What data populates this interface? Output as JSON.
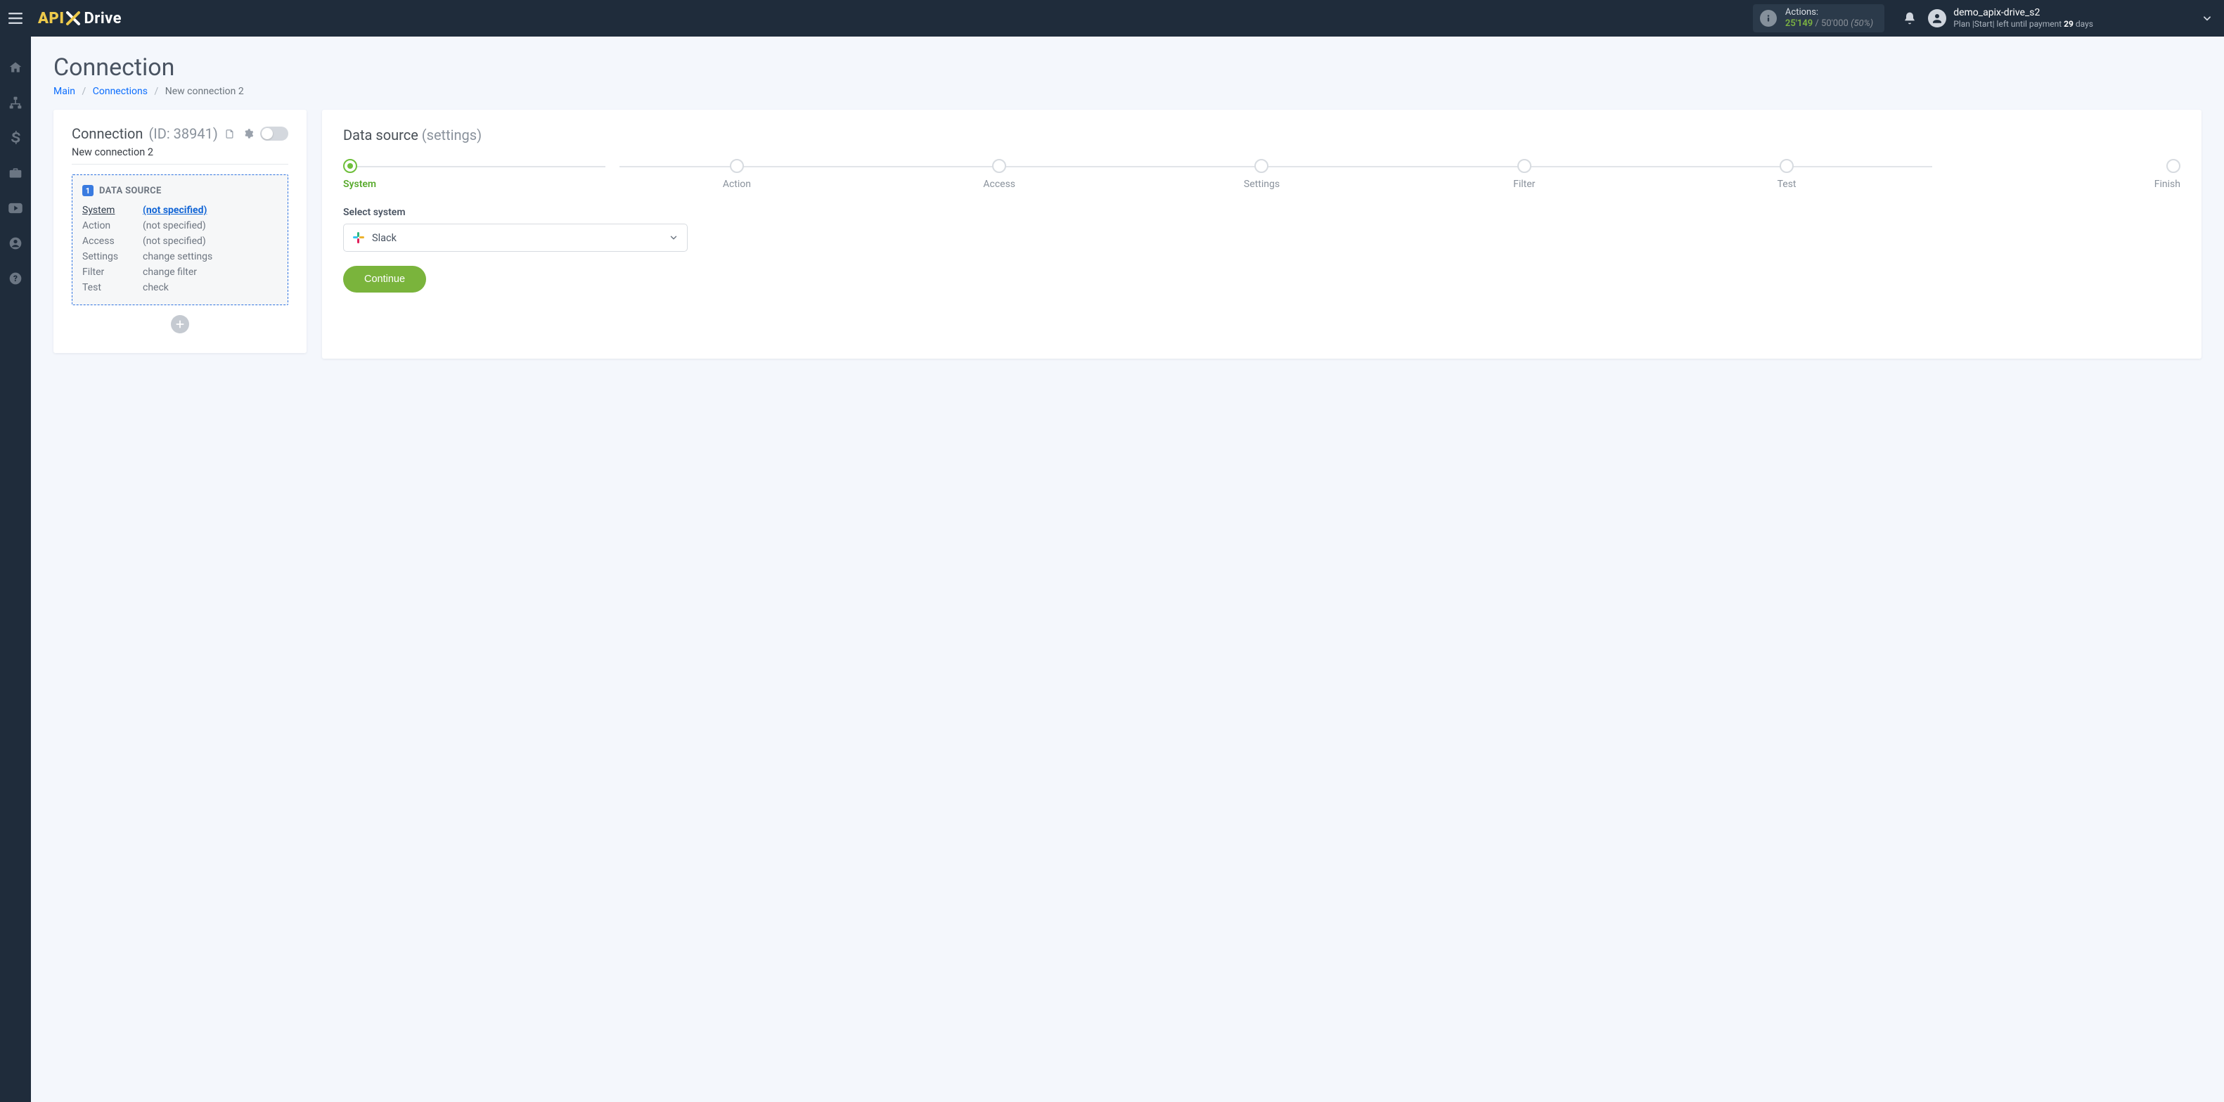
{
  "brand": {
    "api": "API",
    "drive": "Drive"
  },
  "topbar": {
    "actions_label": "Actions:",
    "actions_used": "25'149",
    "actions_sep": " / ",
    "actions_limit": "50'000",
    "actions_pct": "(50%)",
    "user_name": "demo_apix-drive_s2",
    "plan_prefix": "Plan |",
    "plan_name": "Start",
    "plan_middle": "| left until payment ",
    "plan_days": "29",
    "plan_suffix": " days"
  },
  "page": {
    "title": "Connection",
    "breadcrumbs": {
      "main": "Main",
      "connections": "Connections",
      "current": "New connection 2"
    }
  },
  "left_card": {
    "title": "Connection",
    "id_label": "(ID: 38941)",
    "connection_name": "New connection 2",
    "ds_badge": "1",
    "ds_heading": "DATA SOURCE",
    "rows": [
      {
        "key": "System",
        "value": "(not specified)",
        "active": true,
        "link": true
      },
      {
        "key": "Action",
        "value": "(not specified)",
        "active": false,
        "link": false
      },
      {
        "key": "Access",
        "value": "(not specified)",
        "active": false,
        "link": false
      },
      {
        "key": "Settings",
        "value": "change settings",
        "active": false,
        "link": false
      },
      {
        "key": "Filter",
        "value": "change filter",
        "active": false,
        "link": false
      },
      {
        "key": "Test",
        "value": "check",
        "active": false,
        "link": false
      }
    ]
  },
  "right_card": {
    "title": "Data source",
    "title_suffix": "(settings)",
    "steps": [
      "System",
      "Action",
      "Access",
      "Settings",
      "Filter",
      "Test",
      "Finish"
    ],
    "active_step_index": 0,
    "field_label": "Select system",
    "selected_system": "Slack",
    "continue_label": "Continue"
  }
}
